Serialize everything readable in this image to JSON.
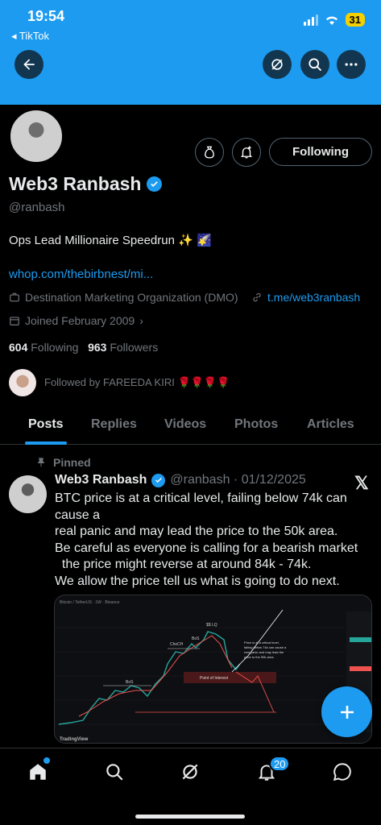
{
  "status_bar": {
    "time": "19:54",
    "back_app": "◂ TikTok",
    "battery": "31"
  },
  "profile": {
    "name": "Web3 Ranbash",
    "handle": "@ranbash",
    "bio": "Ops Lead Millionaire Speedrun ✨ 🌠",
    "link": "whop.com/thebirbnest/mi...",
    "category": "Destination Marketing Organization (DMO)",
    "website": "t.me/web3ranbash",
    "joined": "Joined February 2009",
    "following_count": "604",
    "following_label": "Following",
    "followers_count": "963",
    "followers_label": "Followers",
    "followed_by": "Followed by FAREEDA KIRI 🌹🌹🌹🌹",
    "follow_button": "Following"
  },
  "tabs": [
    {
      "label": "Posts",
      "active": true
    },
    {
      "label": "Replies",
      "active": false
    },
    {
      "label": "Videos",
      "active": false
    },
    {
      "label": "Photos",
      "active": false
    },
    {
      "label": "Articles",
      "active": false
    }
  ],
  "post": {
    "pinned_label": "Pinned",
    "author": "Web3 Ranbash",
    "handle_date": "@ranbash · 01/12/2025",
    "lines": [
      "BTC price is at a critical level, failing below 74k can",
      "cause a",
      "real panic and may lead the price to the 50k area.",
      "Be careful as everyone is calling for a bearish market",
      "  the price might reverse at around 84k - 74k.",
      "We allow the price tell us what is going to do next."
    ],
    "chart_image": {
      "source_label": "TradingView",
      "header_text": "Bitcoin / TetherUS · 1W · Binance",
      "labels": [
        "BoS",
        "ChoCH",
        "BoS",
        "$$ LQ",
        "Point of Interest"
      ],
      "note": "Price is at a critical level, failing below 74k can cause a real panic and may lead the price to the 50k area."
    }
  },
  "bottom_nav": {
    "notification_badge": "20"
  },
  "colors": {
    "accent": "#1d9bf0",
    "background": "#000000",
    "muted": "#71767b"
  }
}
